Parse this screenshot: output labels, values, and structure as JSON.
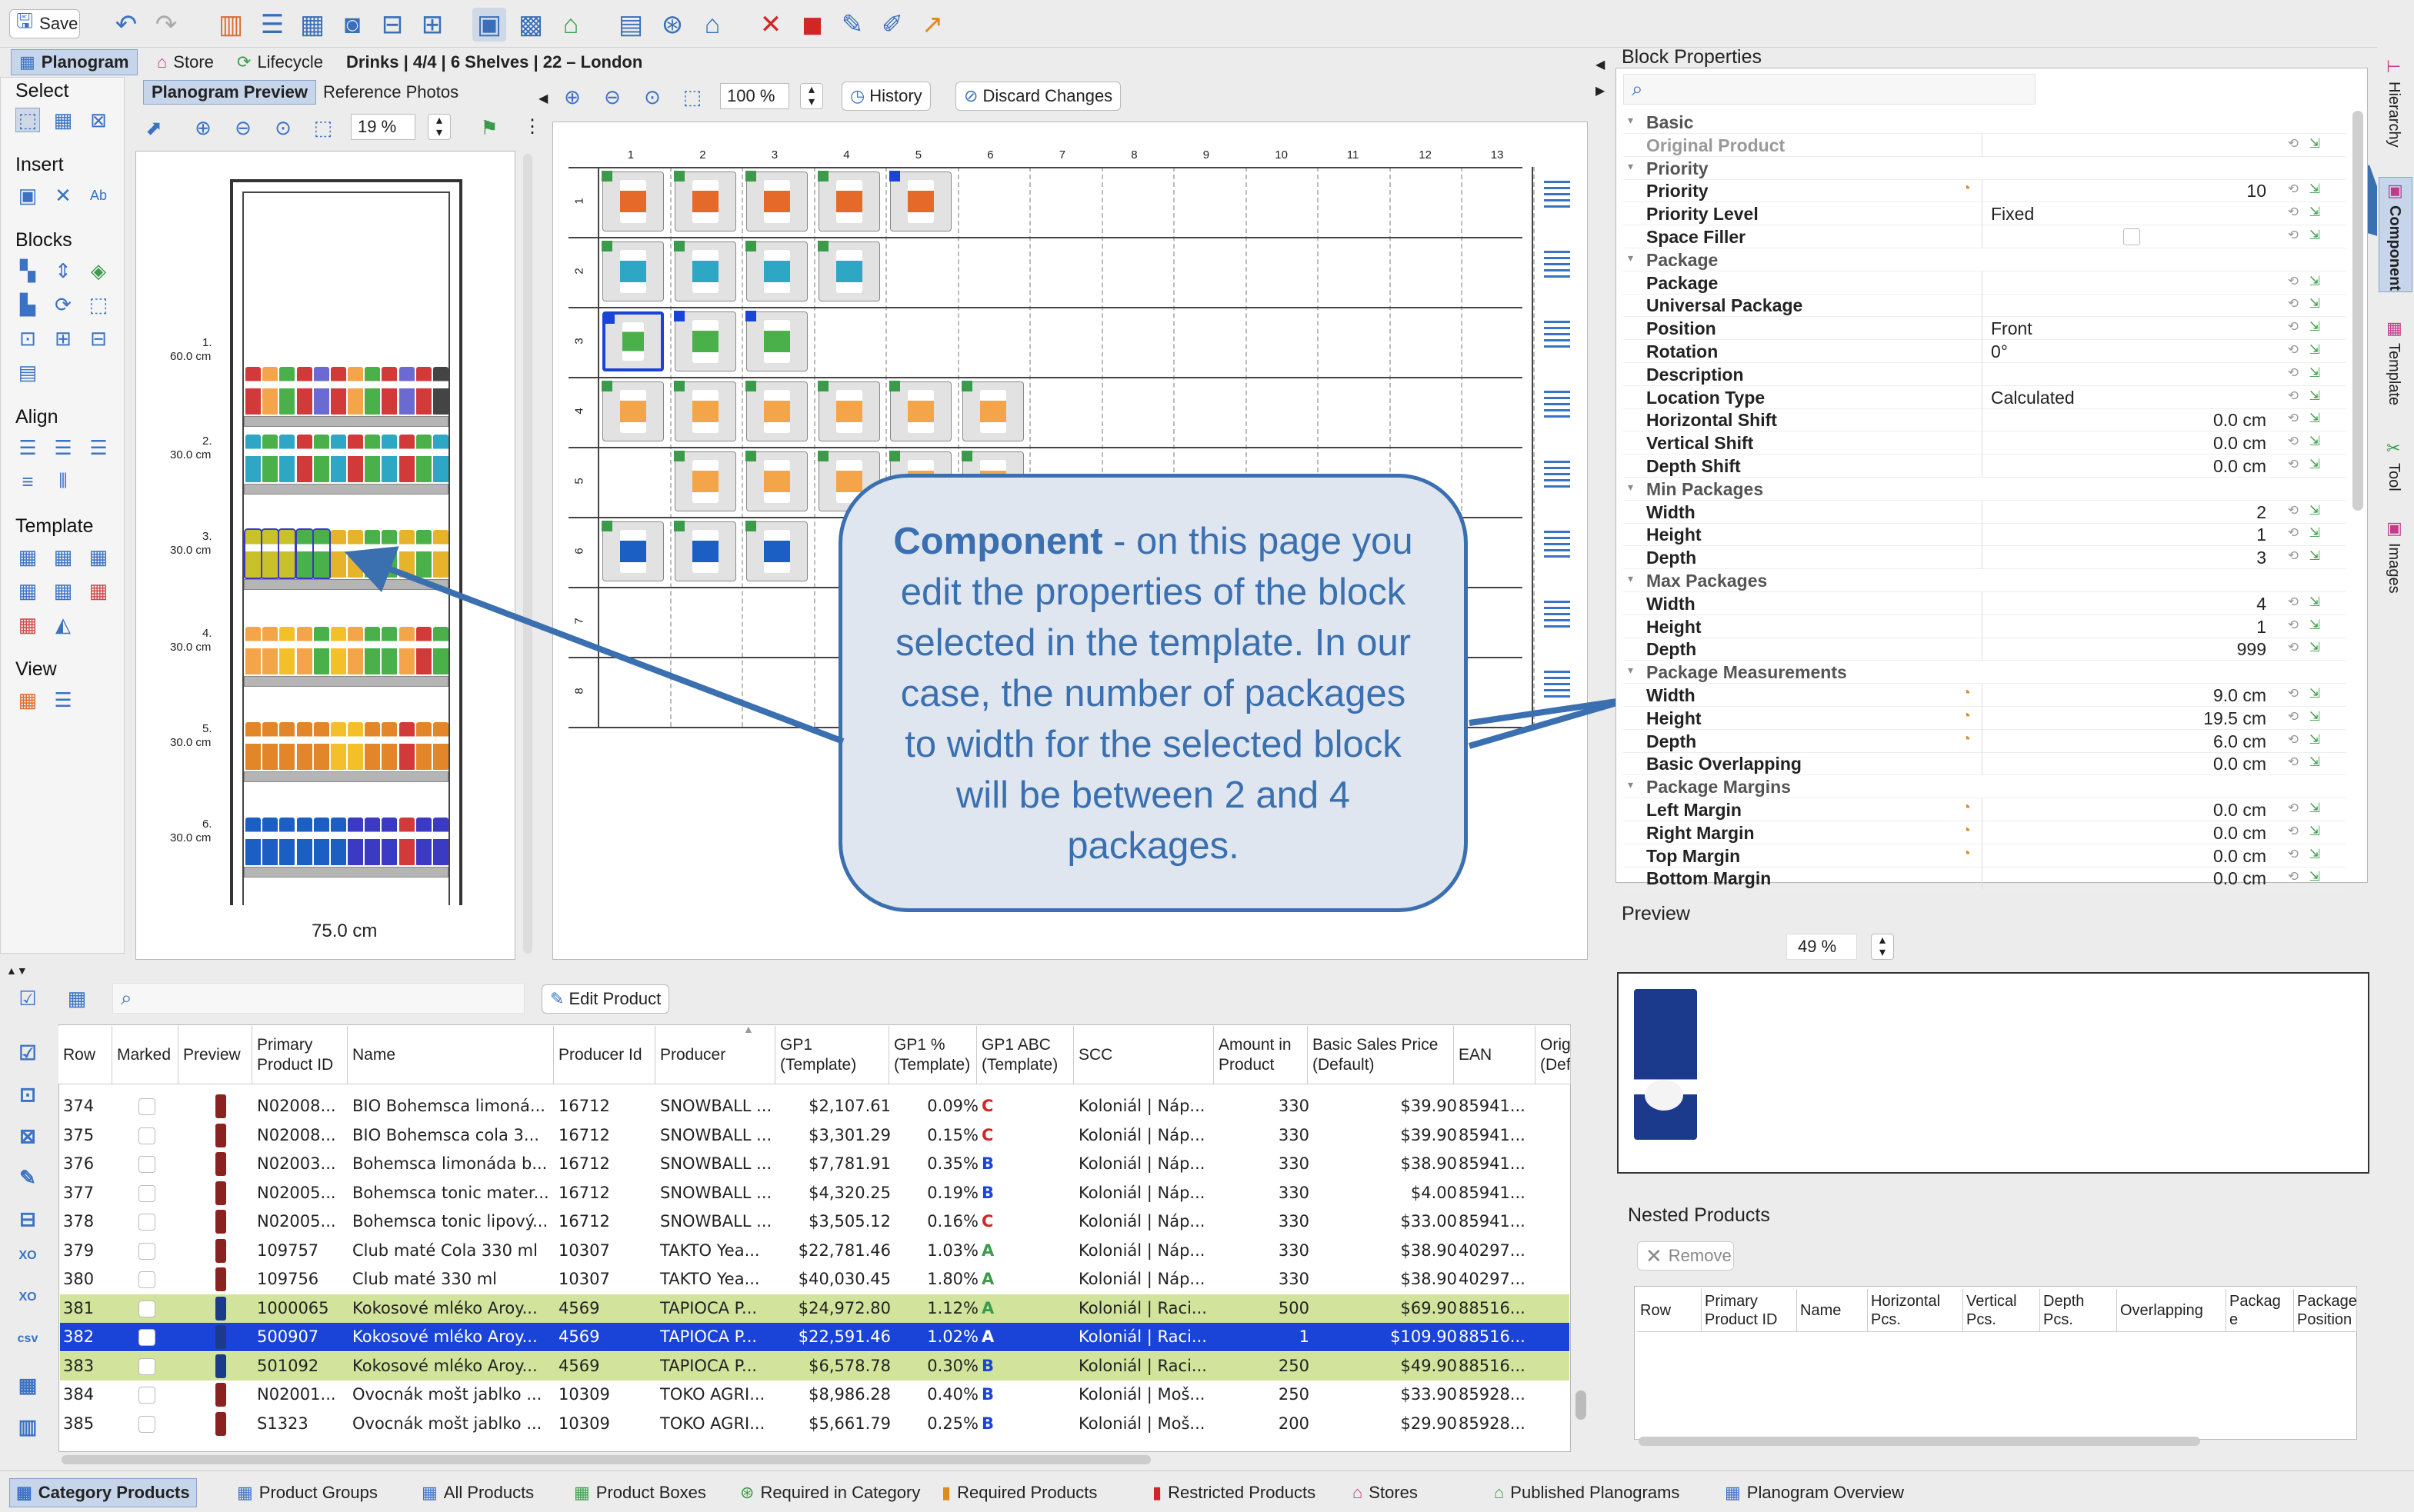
{
  "toolbar": {
    "save_label": "Save"
  },
  "top_tabs": {
    "planogram": "Planogram",
    "store": "Store",
    "lifecycle": "Lifecycle",
    "info": "Drinks | 4/4 | 6 Shelves | 22 – London"
  },
  "left_panel": {
    "select": "Select",
    "insert": "Insert",
    "blocks": "Blocks",
    "align": "Align",
    "template": "Template",
    "view": "View"
  },
  "preview_tabs": {
    "planogram_preview": "Planogram Preview",
    "reference_photos": "Reference Photos",
    "zoom": "19 %"
  },
  "shelf": {
    "labels": [
      "1.",
      "2.",
      "3.",
      "4.",
      "5.",
      "6."
    ],
    "heights": [
      "60.0 cm",
      "30.0 cm",
      "30.0 cm",
      "30.0 cm",
      "30.0 cm",
      "30.0 cm"
    ],
    "width": "75.0 cm"
  },
  "template_editor": {
    "zoom": "100 %",
    "history": "History",
    "discard": "Discard Changes",
    "columns": [
      "1",
      "2",
      "3",
      "4",
      "5",
      "6",
      "7",
      "8",
      "9",
      "10",
      "11",
      "12",
      "13"
    ],
    "rows": [
      "1",
      "2",
      "3",
      "4",
      "5",
      "6",
      "7",
      "8"
    ]
  },
  "callout": {
    "bold": "Component",
    "text": " - on this page you edit the properties of the block selected in the template. In our case, the number of packages to width for the selected block will be between 2 and 4 packages."
  },
  "block_properties": {
    "title": "Block Properties",
    "rows": [
      {
        "kind": "group",
        "name": "Basic"
      },
      {
        "kind": "gray",
        "name": "Original Product"
      },
      {
        "kind": "group",
        "name": "Priority"
      },
      {
        "kind": "prop",
        "name": "Priority",
        "num": "10"
      },
      {
        "kind": "prop",
        "name": "Priority Level",
        "val": "Fixed"
      },
      {
        "kind": "prop",
        "name": "Space Filler"
      },
      {
        "kind": "group",
        "name": "Package"
      },
      {
        "kind": "prop",
        "name": "Package"
      },
      {
        "kind": "prop",
        "name": "Universal Package"
      },
      {
        "kind": "prop",
        "name": "Position",
        "val": "Front"
      },
      {
        "kind": "prop",
        "name": "Rotation",
        "val": "0°"
      },
      {
        "kind": "prop",
        "name": "Description"
      },
      {
        "kind": "prop",
        "name": "Location Type",
        "val": "Calculated"
      },
      {
        "kind": "prop",
        "name": "Horizontal Shift",
        "num": "0.0 cm"
      },
      {
        "kind": "prop",
        "name": "Vertical Shift",
        "num": "0.0 cm"
      },
      {
        "kind": "prop",
        "name": "Depth Shift",
        "num": "0.0 cm"
      },
      {
        "kind": "group",
        "name": "Min Packages"
      },
      {
        "kind": "prop",
        "name": "Width",
        "num": "2"
      },
      {
        "kind": "prop",
        "name": "Height",
        "num": "1"
      },
      {
        "kind": "prop",
        "name": "Depth",
        "num": "3"
      },
      {
        "kind": "group",
        "name": "Max Packages"
      },
      {
        "kind": "prop",
        "name": "Width",
        "num": "4"
      },
      {
        "kind": "prop",
        "name": "Height",
        "num": "1"
      },
      {
        "kind": "prop",
        "name": "Depth",
        "num": "999"
      },
      {
        "kind": "group",
        "name": "Package Measurements"
      },
      {
        "kind": "prop",
        "name": "Width",
        "num": "9.0 cm"
      },
      {
        "kind": "prop",
        "name": "Height",
        "num": "19.5 cm"
      },
      {
        "kind": "prop",
        "name": "Depth",
        "num": "6.0 cm"
      },
      {
        "kind": "prop",
        "name": "Basic Overlapping",
        "num": "0.0 cm"
      },
      {
        "kind": "group",
        "name": "Package Margins"
      },
      {
        "kind": "prop",
        "name": "Left Margin",
        "num": "0.0 cm"
      },
      {
        "kind": "prop",
        "name": "Right Margin",
        "num": "0.0 cm"
      },
      {
        "kind": "prop",
        "name": "Top Margin",
        "num": "0.0 cm"
      },
      {
        "kind": "prop",
        "name": "Bottom Margin",
        "num": "0.0 cm"
      }
    ]
  },
  "right_tabs": [
    "Hierarchy",
    "Component",
    "Template",
    "Tool",
    "Images"
  ],
  "preview": {
    "title": "Preview",
    "zoom": "49 %"
  },
  "nested": {
    "title": "Nested Products",
    "remove": "Remove",
    "columns": [
      "Row",
      "Primary Product ID",
      "Name",
      "Horizontal Pcs.",
      "Vertical Pcs.",
      "Depth Pcs.",
      "Overlapping",
      "Packag e",
      "Package Position"
    ]
  },
  "table": {
    "edit_product": "Edit Product",
    "headers": [
      "Row",
      "Marked",
      "Preview",
      "Primary Product ID",
      "Name",
      "Producer Id",
      "Producer",
      "GP1 (Template)",
      "GP1 % (Template)",
      "GP1 ABC (Template)",
      "SCC",
      "Amount in Product",
      "Basic Sales Price (Default)",
      "EAN",
      "Orig (Def"
    ],
    "rows": [
      [
        "374",
        "N02008...",
        "BIO Bohemsca limoná...",
        "16712",
        "SNOWBALL ...",
        "$2,107.61",
        "0.09%",
        "C",
        "Koloniál | Náp...",
        "330",
        "$39.90",
        "85941..."
      ],
      [
        "375",
        "N02008...",
        "BIO Bohemsca cola 3...",
        "16712",
        "SNOWBALL ...",
        "$3,301.29",
        "0.15%",
        "C",
        "Koloniál | Náp...",
        "330",
        "$39.90",
        "85941..."
      ],
      [
        "376",
        "N02003...",
        "Bohemsca limonáda b...",
        "16712",
        "SNOWBALL ...",
        "$7,781.91",
        "0.35%",
        "B",
        "Koloniál | Náp...",
        "330",
        "$38.90",
        "85941..."
      ],
      [
        "377",
        "N02005...",
        "Bohemsca tonic mater...",
        "16712",
        "SNOWBALL ...",
        "$4,320.25",
        "0.19%",
        "B",
        "Koloniál | Náp...",
        "330",
        "$4.00",
        "85941..."
      ],
      [
        "378",
        "N02005...",
        "Bohemsca tonic lipový...",
        "16712",
        "SNOWBALL ...",
        "$3,505.12",
        "0.16%",
        "C",
        "Koloniál | Náp...",
        "330",
        "$33.00",
        "85941..."
      ],
      [
        "379",
        "109757",
        "Club maté Cola 330 ml",
        "10307",
        "TAKTO Yea...",
        "$22,781.46",
        "1.03%",
        "A",
        "Koloniál | Náp...",
        "330",
        "$38.90",
        "40297..."
      ],
      [
        "380",
        "109756",
        "Club maté 330 ml",
        "10307",
        "TAKTO Yea...",
        "$40,030.45",
        "1.80%",
        "A",
        "Koloniál | Náp...",
        "330",
        "$38.90",
        "40297..."
      ],
      [
        "381",
        "1000065",
        "Kokosové mléko Aroy...",
        "4569",
        "TAPIOCA P...",
        "$24,972.80",
        "1.12%",
        "A",
        "Koloniál | Raci...",
        "500",
        "$69.90",
        "88516..."
      ],
      [
        "382",
        "500907",
        "Kokosové mléko Aroy...",
        "4569",
        "TAPIOCA P...",
        "$22,591.46",
        "1.02%",
        "A",
        "Koloniál | Raci...",
        "1",
        "$109.90",
        "88516..."
      ],
      [
        "383",
        "501092",
        "Kokosové mléko Aroy...",
        "4569",
        "TAPIOCA P...",
        "$6,578.78",
        "0.30%",
        "B",
        "Koloniál | Raci...",
        "250",
        "$49.90",
        "88516..."
      ],
      [
        "384",
        "N02001...",
        "Ovocnák mošt jablko ...",
        "10309",
        "TOKO AGRI...",
        "$8,986.28",
        "0.40%",
        "B",
        "Koloniál | Moš...",
        "250",
        "$33.90",
        "85928..."
      ],
      [
        "385",
        "S1323",
        "Ovocnák mošt jablko ...",
        "10309",
        "TOKO AGRI...",
        "$5,661.79",
        "0.25%",
        "B",
        "Koloniál | Moš...",
        "200",
        "$29.90",
        "85928..."
      ]
    ]
  },
  "bottom_tabs": [
    "Category Products",
    "Product Groups",
    "All Products",
    "Product Boxes",
    "Required in Category",
    "Required Products",
    "Restricted Products",
    "Stores",
    "Published Planograms",
    "Planogram Overview"
  ],
  "colors": {
    "accent": "#3a72c4",
    "selected_row": "#1a44d8",
    "highlight_row": "#d2e39c",
    "callout_bg": "#dfe6ef",
    "callout_border": "#3a6fb0"
  }
}
